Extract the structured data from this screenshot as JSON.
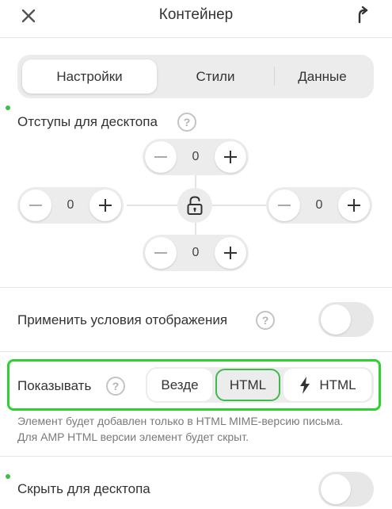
{
  "header": {
    "title": "Контейнер",
    "close_icon": "close-icon",
    "pin_icon": "pin-icon"
  },
  "tabs": [
    {
      "label": "Настройки",
      "active": true
    },
    {
      "label": "Стили",
      "active": false
    },
    {
      "label": "Данные",
      "active": false
    }
  ],
  "padding": {
    "label": "Отступы для десктопа",
    "help": "?",
    "top": "0",
    "left": "0",
    "right": "0",
    "bottom": "0",
    "lock_icon": "lock-icon"
  },
  "display_conditions": {
    "label": "Применить условия отображения",
    "help": "?",
    "enabled": false
  },
  "show": {
    "label": "Показывать",
    "help": "?",
    "options": [
      "Везде",
      "HTML",
      "HTML"
    ],
    "selected": "HTML",
    "amp_icon": "lightning-icon",
    "description": "Элемент будет добавлен только в HTML MIME-версию письма. Для AMP HTML версии элемент будет скрыт."
  },
  "hide_desktop": {
    "label": "Скрыть для десктопа",
    "enabled": false
  },
  "colors": {
    "accent": "#2ed12e",
    "indicator": "#3ac145"
  }
}
